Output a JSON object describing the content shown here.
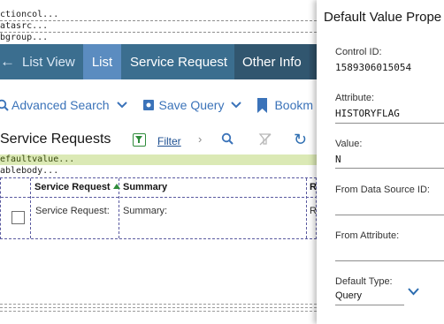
{
  "debug": {
    "line1": "ctioncol...",
    "line2": "atasrc...",
    "line3": "bgroup...",
    "highlight": "efaultvalue...",
    "tablebody": "ablebody..."
  },
  "nav": {
    "list_view": "List View",
    "list": "List",
    "service_request": "Service Request",
    "other_info": "Other Info"
  },
  "toolbar": {
    "advanced_search": "Advanced Search",
    "save_query": "Save Query",
    "bookmarks": "Bookm"
  },
  "section": {
    "title": "Service Requests",
    "filter": "Filter"
  },
  "table": {
    "headers": [
      "Service Request",
      "Summary",
      "R"
    ],
    "rows": [
      [
        "Service Request:",
        "Summary:",
        "R"
      ]
    ]
  },
  "panel": {
    "title": "Default Value Prope",
    "fields": [
      {
        "label": "Control ID:",
        "value": "1589306015054"
      },
      {
        "label": "Attribute:",
        "value": "HISTORYFLAG"
      },
      {
        "label": "Value:",
        "value": "N"
      },
      {
        "label": "From Data Source ID:",
        "value": ""
      },
      {
        "label": "From Attribute:",
        "value": ""
      },
      {
        "label": "Default Type:",
        "value": "Query"
      }
    ]
  },
  "colors": {
    "nav_bg": "#3b6e8f",
    "nav_active": "#5b8cc0",
    "link_blue": "#3b73b9",
    "highlight_bar": "#dbe9b5"
  },
  "icons": [
    "back-arrow-icon",
    "search-icon",
    "chevron-down-icon",
    "save-query-icon",
    "bookmark-icon",
    "filter-icon",
    "chevron-right-icon",
    "clear-filter-icon",
    "refresh-icon",
    "sort-ascending-icon"
  ]
}
